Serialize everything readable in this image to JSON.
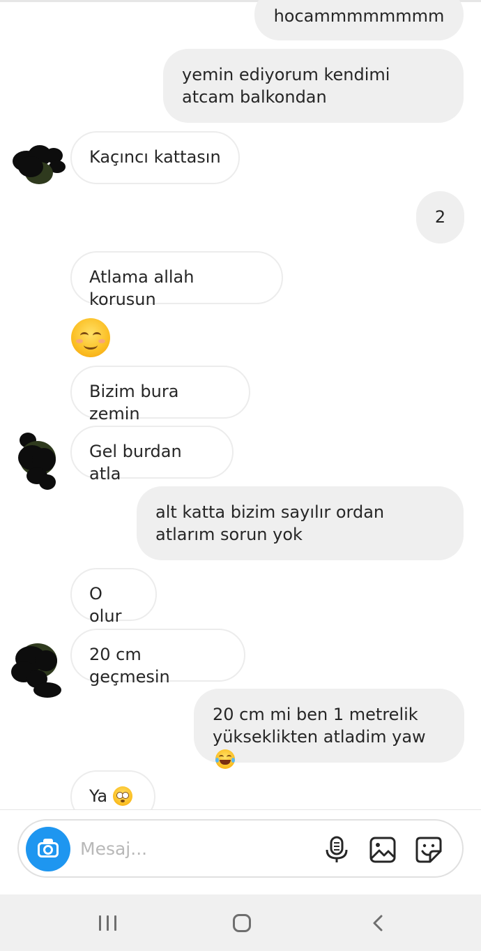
{
  "messages": [
    {
      "text": "hocammmmmmmm"
    },
    {
      "text": "yemin ediyorum kendimi atcam balkondan"
    },
    {
      "text": "Kaçıncı kattasın"
    },
    {
      "text": "2"
    },
    {
      "text": "Atlama allah korusun"
    },
    {
      "emoji": "smiling-face-with-smiling-eyes"
    },
    {
      "text": "Bizim bura zemin"
    },
    {
      "text": "Gel burdan atla"
    },
    {
      "text": "alt katta bizim sayılır ordan atlarım sorun yok"
    },
    {
      "text": "O olur"
    },
    {
      "text": "20 cm geçmesin"
    },
    {
      "text": "20 cm mi ben 1 metrelik yükseklikten atladim yaw",
      "emoji": "face-with-tears-of-joy"
    },
    {
      "text": "Ya",
      "emoji": "flushed-face"
    }
  ],
  "composer": {
    "placeholder": "Mesaj...",
    "icons": [
      "camera-icon",
      "microphone-icon",
      "gallery-icon",
      "sticker-icon"
    ]
  },
  "colors": {
    "accent": "#1e96f0",
    "outgoing_bubble": "#efefef",
    "incoming_border": "#ececec"
  },
  "navbar": {
    "icons": [
      "recent-apps-icon",
      "home-icon",
      "back-icon"
    ]
  }
}
